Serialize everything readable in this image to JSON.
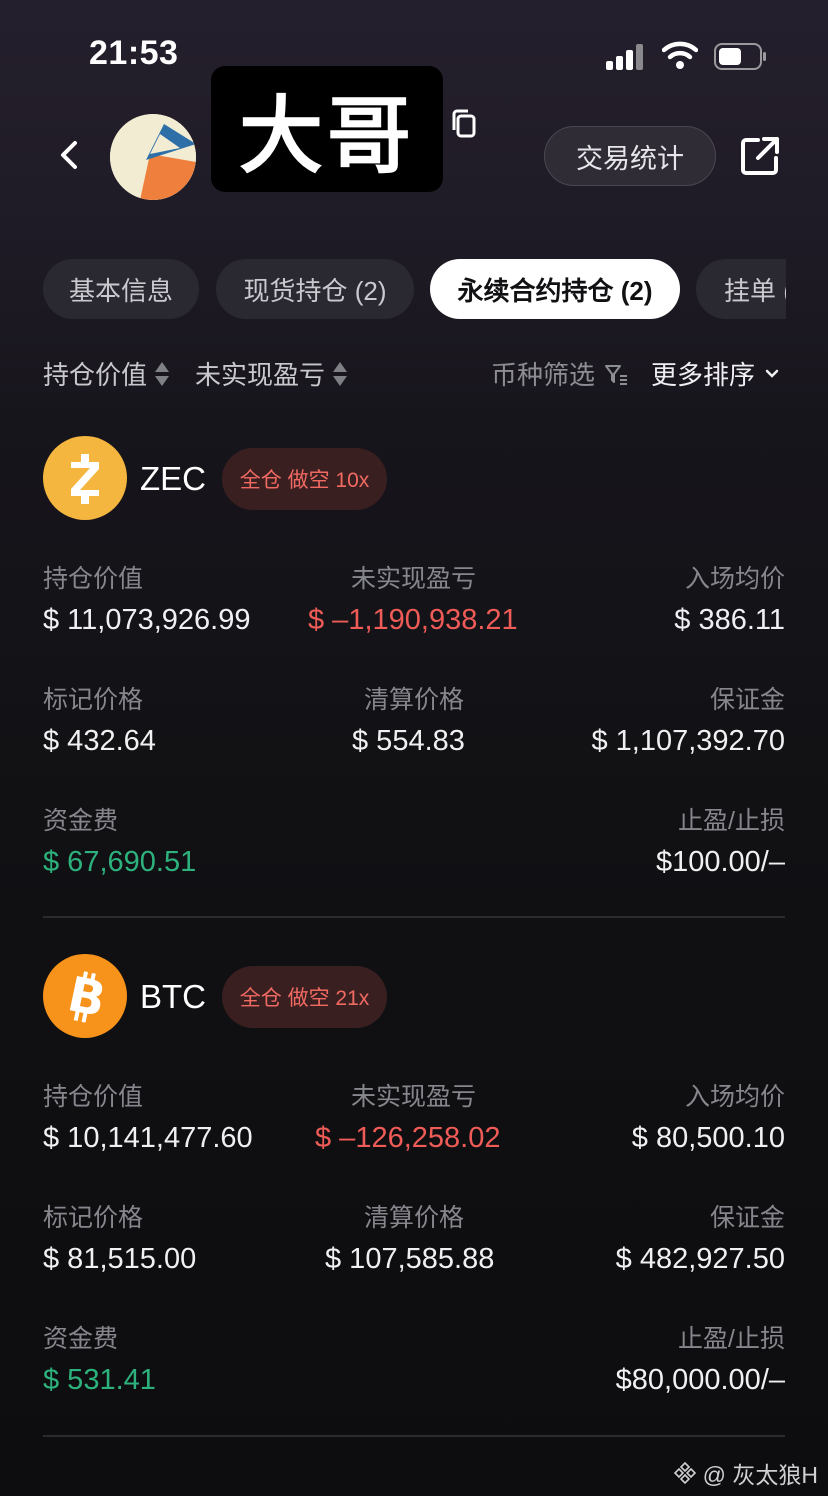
{
  "status_bar": {
    "time": "21:53"
  },
  "header": {
    "name": "大哥",
    "stats_button": "交易统计",
    "icons": [
      "back-icon",
      "copy-icon",
      "share-icon"
    ]
  },
  "tabs": [
    {
      "label": "基本信息",
      "active": false
    },
    {
      "label": "现货持仓 (2)",
      "active": false
    },
    {
      "label": "永续合约持仓 (2)",
      "active": true
    },
    {
      "label": "挂单 (",
      "active": false
    }
  ],
  "sort_bar": {
    "sort1": "持仓价值",
    "sort2": "未实现盈亏",
    "filter": "币种筛选",
    "more_sort": "更多排序"
  },
  "positions": [
    {
      "symbol": "ZEC",
      "badge": "全仓 做空 10x",
      "coin_color": "#f4b63e",
      "position_value_label": "持仓价值",
      "position_value": "$ 11,073,926.99",
      "pnl_label": "未实现盈亏",
      "pnl": "$ –1,190,938.21",
      "entry_label": "入场均价",
      "entry": "$ 386.11",
      "mark_label": "标记价格",
      "mark": "$ 432.64",
      "liq_label": "清算价格",
      "liq": "$ 554.83",
      "margin_label": "保证金",
      "margin": "$ 1,107,392.70",
      "funding_label": "资金费",
      "funding": "$ 67,690.51",
      "tpsl_label": "止盈/止损",
      "tpsl": "$100.00/–"
    },
    {
      "symbol": "BTC",
      "badge": "全仓 做空 21x",
      "coin_color": "#f7931a",
      "position_value_label": "持仓价值",
      "position_value": "$ 10,141,477.60",
      "pnl_label": "未实现盈亏",
      "pnl": "$ –126,258.02",
      "entry_label": "入场均价",
      "entry": "$ 80,500.10",
      "mark_label": "标记价格",
      "mark": "$ 81,515.00",
      "liq_label": "清算价格",
      "liq": "$ 107,585.88",
      "margin_label": "保证金",
      "margin": "$ 482,927.50",
      "funding_label": "资金费",
      "funding": "$ 531.41",
      "tpsl_label": "止盈/止损",
      "tpsl": "$80,000.00/–"
    }
  ],
  "watermark": "@ 灰太狼H"
}
